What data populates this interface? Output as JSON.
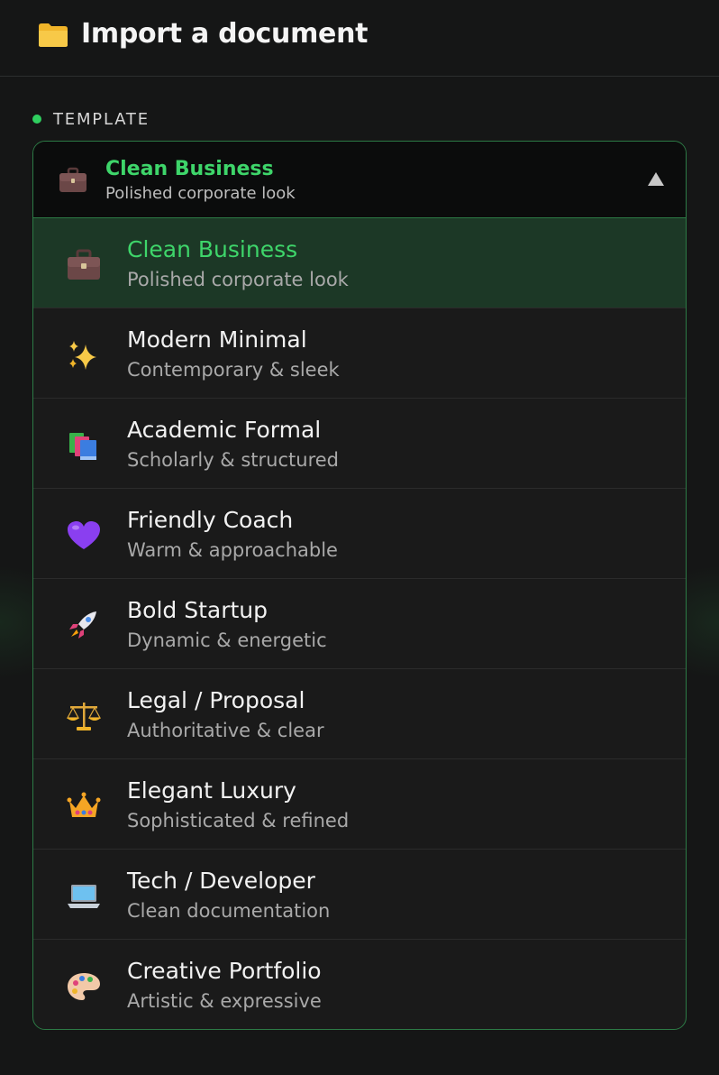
{
  "header": {
    "icon": "folder-icon",
    "title": "Import a document"
  },
  "section": {
    "label": "TEMPLATE",
    "status_color": "#2fcf5f"
  },
  "dropdown": {
    "selected": {
      "icon": "briefcase-icon",
      "title": "Clean Business",
      "subtitle": "Polished corporate look"
    },
    "expanded": true,
    "accent_color": "#3ed56a",
    "options": [
      {
        "icon": "briefcase-icon",
        "title": "Clean Business",
        "subtitle": "Polished corporate look",
        "selected": true
      },
      {
        "icon": "sparkles-icon",
        "title": "Modern Minimal",
        "subtitle": "Contemporary & sleek",
        "selected": false
      },
      {
        "icon": "books-icon",
        "title": "Academic Formal",
        "subtitle": "Scholarly & structured",
        "selected": false
      },
      {
        "icon": "purple-heart-icon",
        "title": "Friendly Coach",
        "subtitle": "Warm & approachable",
        "selected": false
      },
      {
        "icon": "rocket-icon",
        "title": "Bold Startup",
        "subtitle": "Dynamic & energetic",
        "selected": false
      },
      {
        "icon": "balance-scale-icon",
        "title": "Legal / Proposal",
        "subtitle": "Authoritative & clear",
        "selected": false
      },
      {
        "icon": "crown-icon",
        "title": "Elegant Luxury",
        "subtitle": "Sophisticated & refined",
        "selected": false
      },
      {
        "icon": "laptop-icon",
        "title": "Tech / Developer",
        "subtitle": "Clean documentation",
        "selected": false
      },
      {
        "icon": "palette-icon",
        "title": "Creative Portfolio",
        "subtitle": "Artistic & expressive",
        "selected": false
      }
    ]
  }
}
